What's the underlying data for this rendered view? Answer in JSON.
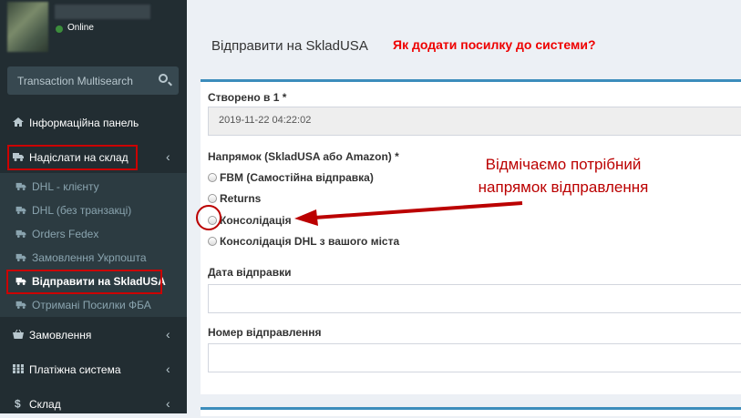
{
  "user": {
    "status": "Online"
  },
  "search": {
    "placeholder": "Transaction Multisearch"
  },
  "sidebar": {
    "items": [
      {
        "label": "Інформаційна панель",
        "icon": "home-icon"
      },
      {
        "label": "Надіслати на склад",
        "icon": "truck-icon"
      }
    ],
    "sub_items": [
      {
        "label": "DHL - клієнту"
      },
      {
        "label": "DHL (без транзакці)"
      },
      {
        "label": "Orders Fedex"
      },
      {
        "label": "Замовлення Укрпошта"
      },
      {
        "label": "Відправити на SkladUSA"
      },
      {
        "label": "Отримані Посилки ФБА"
      }
    ],
    "bottom_items": [
      {
        "label": "Замовлення",
        "icon": "basket-icon"
      },
      {
        "label": "Платіжна система",
        "icon": "grid-icon"
      },
      {
        "label": "Склад",
        "icon": "dollar-icon"
      }
    ]
  },
  "main": {
    "title": "Відправити на SkladUSA",
    "howto_link": "Як додати посилку до системи?",
    "created_label": "Створено в 1 *",
    "created_value": "2019-11-22 04:22:02",
    "direction_label": "Напрямок (SkladUSA або Amazon) *",
    "options": [
      "FBM (Самостійна відправка)",
      "Returns",
      "Консолідація",
      "Консолідація DHL з вашого міста"
    ],
    "ship_date_label": "Дата відправки",
    "tracking_label": "Номер відправлення"
  },
  "annotation": {
    "line1": "Відмічаємо потрібний",
    "line2": "напрямок відправлення"
  },
  "colors": {
    "sidebar": "#222d32",
    "accent": "#3c8dbc",
    "annotation": "#b00000",
    "link": "#ee0000"
  }
}
